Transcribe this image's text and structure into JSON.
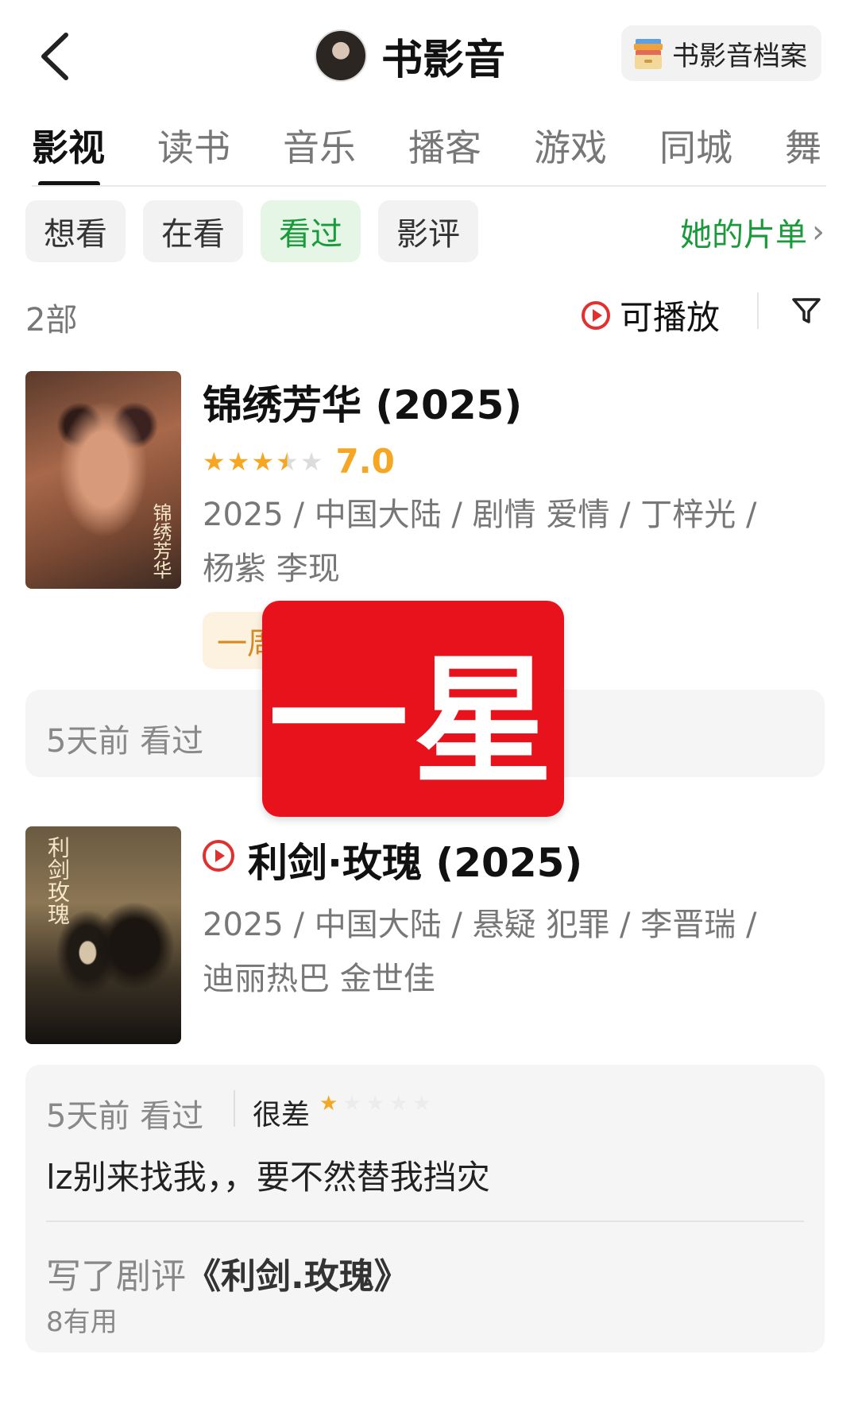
{
  "header": {
    "title": "书影音",
    "archive_label": "书影音档案",
    "back_icon": "chevron-left-icon",
    "archive_icon": "archive-box-icon"
  },
  "tabs": [
    {
      "label": "影视",
      "active": true
    },
    {
      "label": "读书"
    },
    {
      "label": "音乐"
    },
    {
      "label": "播客"
    },
    {
      "label": "游戏"
    },
    {
      "label": "同城"
    },
    {
      "label": "舞"
    }
  ],
  "chips": [
    {
      "label": "想看"
    },
    {
      "label": "在看"
    },
    {
      "label": "看过",
      "active": true
    },
    {
      "label": "影评"
    }
  ],
  "her_list": {
    "label": "她的片单",
    "arrow": "›"
  },
  "summary": {
    "count": "2部",
    "playable_label": "可播放"
  },
  "items": [
    {
      "title": "锦绣芳华 (2025)",
      "rating": "7.0",
      "stars": 3.5,
      "meta_line1": "2025 / 中国大陆 / 剧情 爱情 / 丁梓光 /",
      "meta_line2": "杨紫 李现",
      "tag": "一周",
      "poster_caption": "锦绣芳华",
      "card_time": "5天前 看过"
    },
    {
      "title": "利剑·玫瑰 (2025)",
      "meta_line1": "2025 / 中国大陆 / 悬疑 犯罪 / 李晋瑞 /",
      "meta_line2": "迪丽热巴 金世佳",
      "poster_caption": "利剑玫瑰",
      "card_time": "5天前 看过",
      "rating_label": "很差",
      "user_stars": 1,
      "comment": "lz别来找我，，要不然替我挡灾",
      "review_prefix": "写了剧评",
      "review_title": "《利剑.玫瑰》",
      "useful": "8有用"
    }
  ],
  "overlay": {
    "text": "一星",
    "color": "#e8121c"
  },
  "colors": {
    "accent_green": "#1a9a3a",
    "star": "#f5a623",
    "play_red": "#e0312f"
  }
}
